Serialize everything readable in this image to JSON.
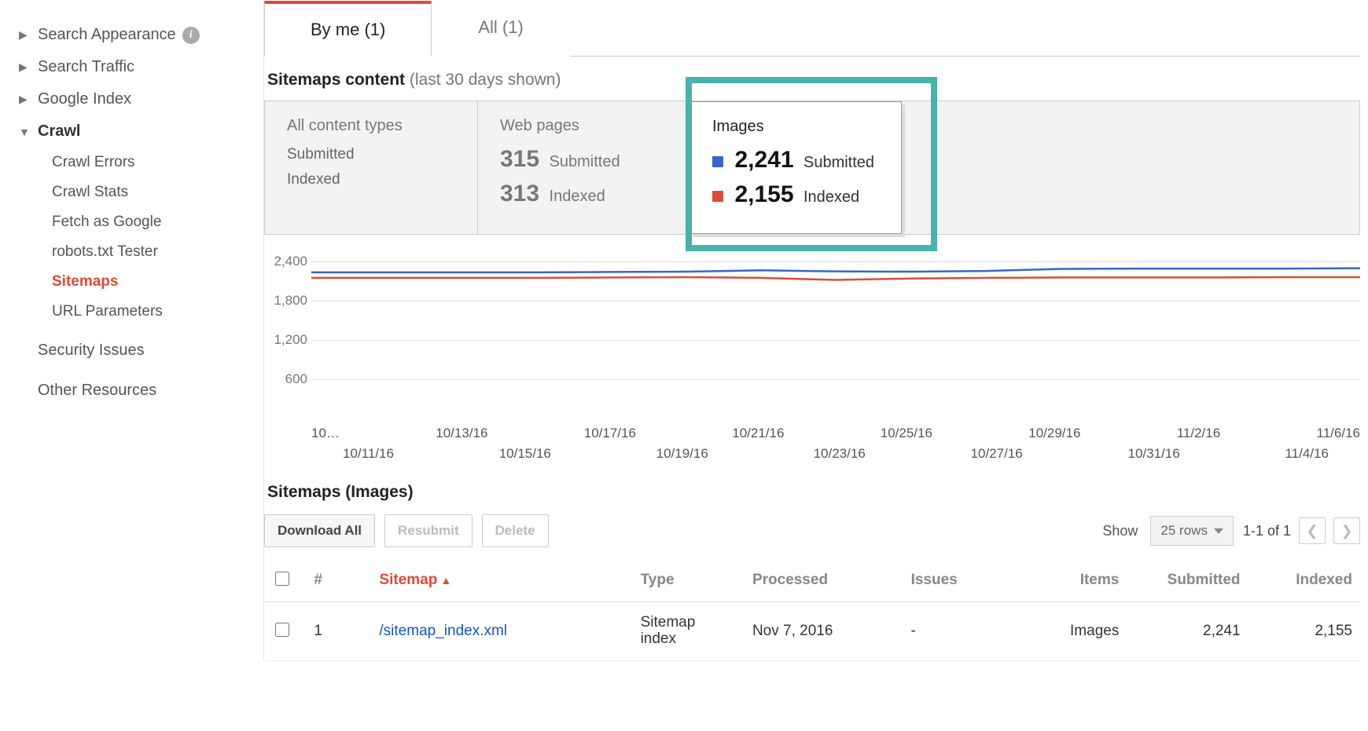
{
  "sidebar": {
    "groups": [
      {
        "label": "Search Appearance",
        "expanded": false,
        "info": true
      },
      {
        "label": "Search Traffic",
        "expanded": false,
        "info": false
      },
      {
        "label": "Google Index",
        "expanded": false,
        "info": false
      }
    ],
    "crawl": {
      "label": "Crawl",
      "items": [
        {
          "label": "Crawl Errors",
          "active": false
        },
        {
          "label": "Crawl Stats",
          "active": false
        },
        {
          "label": "Fetch as Google",
          "active": false
        },
        {
          "label": "robots.txt Tester",
          "active": false
        },
        {
          "label": "Sitemaps",
          "active": true
        },
        {
          "label": "URL Parameters",
          "active": false
        }
      ]
    },
    "security_label": "Security Issues",
    "other_label": "Other Resources"
  },
  "tabs": {
    "by_me": "By me (1)",
    "all": "All (1)"
  },
  "sitemaps_content": {
    "title_bold": "Sitemaps content",
    "title_muted": "(last 30 days shown)",
    "all_types": {
      "header": "All content types",
      "row1": "Submitted",
      "row2": "Indexed"
    },
    "web_pages": {
      "header": "Web pages",
      "submitted_n": "315",
      "submitted_l": "Submitted",
      "indexed_n": "313",
      "indexed_l": "Indexed"
    },
    "images": {
      "header": "Images",
      "submitted_n": "2,241",
      "submitted_l": "Submitted",
      "indexed_n": "2,155",
      "indexed_l": "Indexed"
    }
  },
  "chart_data": {
    "type": "line",
    "title": "",
    "ylabel": "",
    "xlabel": "",
    "ylim": [
      0,
      2400
    ],
    "y_ticks": [
      "2,400",
      "1,800",
      "1,200",
      "600"
    ],
    "x_ticks_row1": [
      "10…",
      "10/13/16",
      "10/17/16",
      "10/21/16",
      "10/25/16",
      "10/29/16",
      "11/2/16",
      "11/6/16"
    ],
    "x_ticks_row2": [
      "10/11/16",
      "10/15/16",
      "10/19/16",
      "10/23/16",
      "10/27/16",
      "10/31/16",
      "11/4/16"
    ],
    "categories": [
      "10/9/16",
      "10/11/16",
      "10/13/16",
      "10/15/16",
      "10/17/16",
      "10/19/16",
      "10/21/16",
      "10/23/16",
      "10/25/16",
      "10/27/16",
      "10/29/16",
      "10/31/16",
      "11/2/16",
      "11/4/16",
      "11/6/16"
    ],
    "series": [
      {
        "name": "Submitted",
        "color": "#3666cc",
        "values": [
          2230,
          2230,
          2230,
          2230,
          2235,
          2240,
          2260,
          2245,
          2240,
          2250,
          2280,
          2285,
          2285,
          2285,
          2290
        ]
      },
      {
        "name": "Indexed",
        "color": "#dd4b39",
        "values": [
          2150,
          2150,
          2150,
          2150,
          2155,
          2160,
          2150,
          2120,
          2140,
          2150,
          2155,
          2155,
          2155,
          2160,
          2160
        ]
      }
    ]
  },
  "subsection_title": "Sitemaps (Images)",
  "toolbar": {
    "download": "Download All",
    "resubmit": "Resubmit",
    "delete": "Delete",
    "show": "Show",
    "rows": "25 rows",
    "range": "1-1 of 1"
  },
  "table": {
    "headers": {
      "idx": "#",
      "sitemap": "Sitemap",
      "type": "Type",
      "processed": "Processed",
      "issues": "Issues",
      "items": "Items",
      "submitted": "Submitted",
      "indexed": "Indexed"
    },
    "rows": [
      {
        "idx": "1",
        "sitemap": "/sitemap_index.xml",
        "type_l1": "Sitemap",
        "type_l2": "index",
        "processed": "Nov 7, 2016",
        "issues": "-",
        "items": "Images",
        "submitted": "2,241",
        "indexed": "2,155"
      }
    ]
  }
}
